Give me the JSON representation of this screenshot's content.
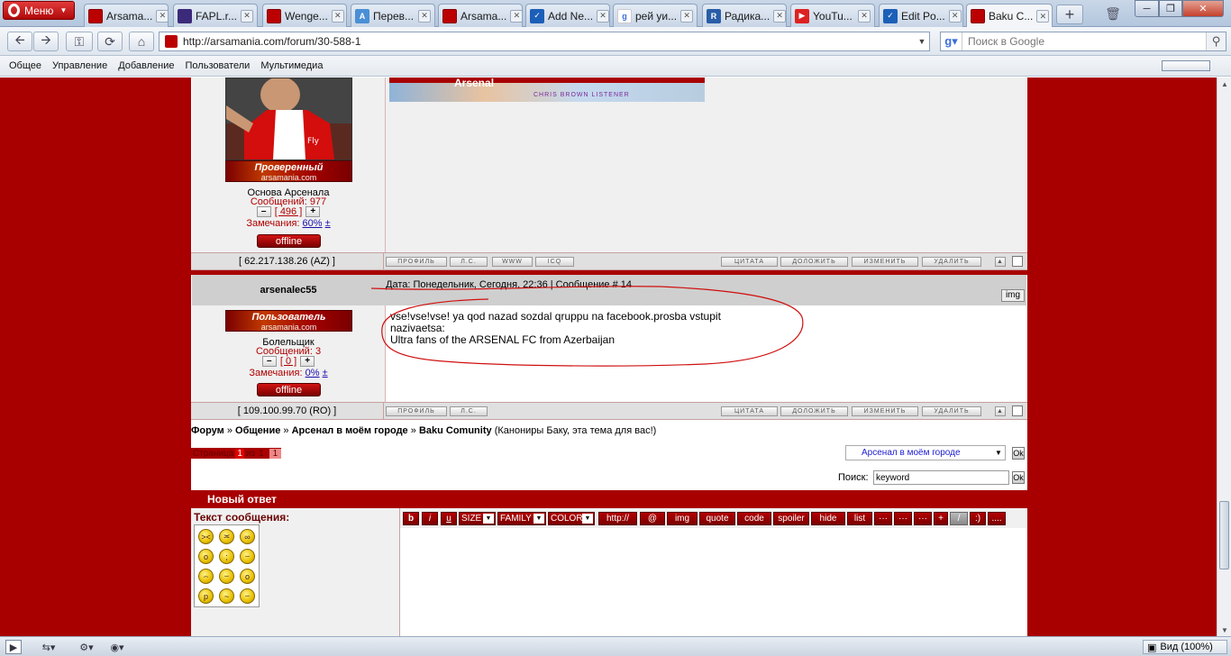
{
  "browser": {
    "menu_label": "Меню",
    "tabs": [
      {
        "title": "Arsama...",
        "favicon": "arsenal-icon"
      },
      {
        "title": "FAPL.r...",
        "favicon": "fapl-icon"
      },
      {
        "title": "Wenge...",
        "favicon": "arsenal-icon"
      },
      {
        "title": "Перев...",
        "favicon": "translate-icon"
      },
      {
        "title": "Arsama...",
        "favicon": "arsenal-icon"
      },
      {
        "title": "Add Ne...",
        "favicon": "mail-icon"
      },
      {
        "title": "рей уи...",
        "favicon": "google-icon"
      },
      {
        "title": "Радика...",
        "favicon": "r-icon"
      },
      {
        "title": "YouTu...",
        "favicon": "youtube-icon"
      },
      {
        "title": "Edit Po...",
        "favicon": "mail-icon"
      },
      {
        "title": "Baku C...",
        "favicon": "arsenal-icon",
        "active": true
      }
    ],
    "url": "http://arsamania.com/forum/30-588-1",
    "search_placeholder": "Поиск в Google",
    "bookmarks": [
      "Общее",
      "Управление",
      "Добавление",
      "Пользователи",
      "Мультимедиа"
    ],
    "zoom_label": "Вид (100%)"
  },
  "post1": {
    "rank_label": "Проверенный",
    "site_label": "arsamania.com",
    "user_group": "Основа Арсенала",
    "messages_label": "Сообщений: 977",
    "reputation": "[ 496 ]",
    "warnings_label": "Замечания:",
    "warnings_value": "60%",
    "warnings_plusminus": "±",
    "status": "offline",
    "ip": "[ 62.217.138.26 (AZ) ]",
    "signature_banner_text": "CHRIS BROWN LISTENER",
    "signature_banner_title": "Arsenal"
  },
  "post2": {
    "username": "arsenalec55",
    "header": "Дата: Понедельник, Сегодня, 22:36 | Сообщение # 14",
    "img_label": "img",
    "rank_label": "Пользователь",
    "site_label": "arsamania.com",
    "user_group": "Болельщик",
    "messages_label": "Сообщений: 3",
    "reputation": "[ 0 ]",
    "warnings_label": "Замечания:",
    "warnings_value": "0%",
    "warnings_plusminus": "±",
    "status": "offline",
    "ip": "[ 109.100.99.70 (RO) ]",
    "body_line1": "vse!vse!vse! ya qod nazad sozdal qruppu na facebook.prosba vstupit",
    "body_line2": "nazivaetsa:",
    "body_line3": "Ultra fans of the ARSENAL FC from Azerbaijan"
  },
  "post_buttons": {
    "left": [
      "ПРОФИЛЬ",
      "Л.С.",
      "WWW",
      "ICQ"
    ],
    "right": [
      "ЦИТАТА",
      "ДОЛОЖИТЬ",
      "ИЗМЕНИТЬ",
      "УДАЛИТЬ"
    ]
  },
  "breadcrumb": {
    "forum": "Форум",
    "sep": "»",
    "section": "Общение",
    "subsection": "Арсенал в моём городе",
    "topic": "Baku Comunity",
    "topic_desc": "(Канониры Баку, эта тема для вас!)"
  },
  "pagination": {
    "label": "Страница",
    "current": "1",
    "of_label": "из",
    "total": "1",
    "page_link": "1"
  },
  "jump": {
    "selected": "Арсенал в моём городе",
    "ok": "Ok"
  },
  "search": {
    "label": "Поиск:",
    "value": "keyword",
    "ok": "Ok"
  },
  "reply": {
    "title": "Новый ответ",
    "message_label": "Текст сообщения:",
    "toolbar": [
      "b",
      "i",
      "u",
      "SIZE",
      "FAMILY",
      "COLOR",
      "http://",
      "@",
      "img",
      "quote",
      "code",
      "spoiler",
      "hide",
      "list",
      "···",
      "···",
      "···",
      "+",
      "/",
      ":)",
      "...."
    ]
  },
  "colors": {
    "page_bg": "#a80000",
    "accent": "#b00000",
    "link": "#1a0dab"
  }
}
